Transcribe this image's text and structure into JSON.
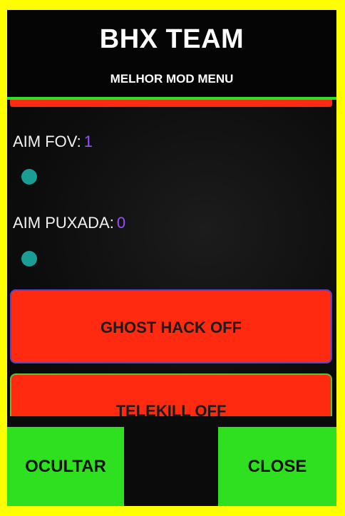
{
  "header": {
    "title": "BHX TEAM",
    "subtitle": "MELHOR MOD MENU"
  },
  "settings": {
    "aim_fov": {
      "label": "AIM FOV:",
      "value": "1"
    },
    "aim_puxada": {
      "label": "AIM PUXADA:",
      "value": "0"
    }
  },
  "toggles": {
    "ghost_hack": "GHOST HACK OFF",
    "telekill": "TELEKILL OFF"
  },
  "footer": {
    "hide_label": "OCULTAR",
    "close_label": "CLOSE"
  },
  "colors": {
    "frame_border": "#ffff00",
    "button_green": "#2fe020",
    "toggle_red": "#ff2a10",
    "value_purple": "#9b4dff",
    "slider_teal": "#1a9d94"
  }
}
